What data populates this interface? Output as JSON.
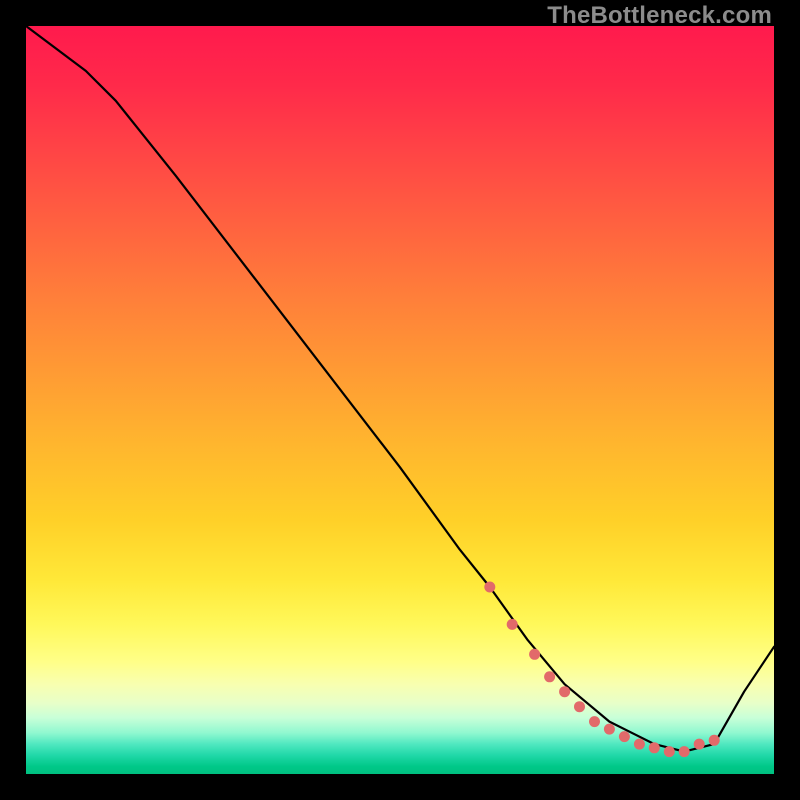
{
  "watermark": "TheBottleneck.com",
  "chart_data": {
    "type": "line",
    "title": "",
    "xlabel": "",
    "ylabel": "",
    "xlim": [
      0,
      100
    ],
    "ylim": [
      0,
      100
    ],
    "background_gradient": {
      "top_color": "#ff1a4d",
      "bottom_color": "#00c080",
      "orientation": "vertical"
    },
    "series": [
      {
        "name": "bottleneck-curve",
        "type": "line",
        "color": "#000000",
        "x": [
          0,
          8,
          12,
          20,
          30,
          40,
          50,
          58,
          62,
          67,
          72,
          78,
          84,
          88,
          92,
          96,
          100
        ],
        "values": [
          100,
          94,
          90,
          80,
          67,
          54,
          41,
          30,
          25,
          18,
          12,
          7,
          4,
          3,
          4,
          11,
          17
        ]
      },
      {
        "name": "optimal-range-markers",
        "type": "scatter",
        "color": "#e26a6a",
        "x": [
          62,
          65,
          68,
          70,
          72,
          74,
          76,
          78,
          80,
          82,
          84,
          86,
          88,
          90,
          92
        ],
        "values": [
          25,
          20,
          16,
          13,
          11,
          9,
          7,
          6,
          5,
          4,
          3.5,
          3,
          3,
          4,
          4.5
        ]
      }
    ]
  }
}
